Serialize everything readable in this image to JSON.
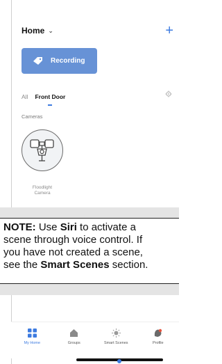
{
  "header": {
    "title": "Home",
    "chevron": "⌄",
    "add_icon": "+"
  },
  "scene": {
    "label": "Recording",
    "icon": "tag-icon",
    "color": "#6792d6"
  },
  "tabs": [
    {
      "label": "All",
      "active": false
    },
    {
      "label": "Front Door",
      "active": true
    }
  ],
  "section": {
    "label": "Cameras"
  },
  "device": {
    "name_line1": "Floodlight",
    "name_line2": "Camera",
    "icon": "floodlight-camera-icon"
  },
  "note": {
    "label": "NOTE:",
    "line1_pre": "Use ",
    "line1_bold": "Siri",
    "line1_post": " to activate a",
    "line2": "scene through voice control. If",
    "line3": "you have not created a scene,",
    "line4_pre": "see the ",
    "line4_bold": "Smart Scenes",
    "line4_post": " section."
  },
  "nav": [
    {
      "label": "My Home",
      "icon": "grid-icon",
      "active": true
    },
    {
      "label": "Groups",
      "icon": "house-icon",
      "active": false
    },
    {
      "label": "Smart Scenes",
      "icon": "sun-icon",
      "active": false
    },
    {
      "label": "Profile",
      "icon": "profile-icon",
      "active": false
    }
  ],
  "colors": {
    "accent": "#3d7be0",
    "note_band": "#e4e4e4"
  }
}
